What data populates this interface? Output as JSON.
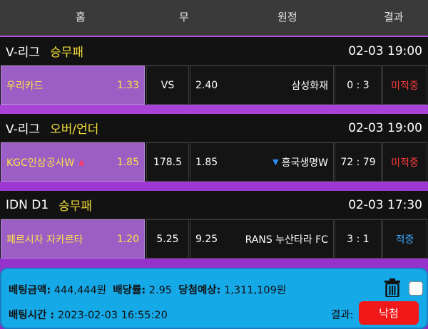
{
  "header": {
    "home": "홈",
    "draw": "무",
    "away": "원정",
    "result": "결과"
  },
  "matches": [
    {
      "league": "V-리그",
      "market": "승무패",
      "time": "02-03 19:00",
      "home_team": "우리카드",
      "home_odds": "1.33",
      "draw": "VS",
      "away_odds": "2.40",
      "away_team": "삼성화재",
      "score": "0 : 3",
      "result": "미적중"
    },
    {
      "league": "V-리그",
      "market": "오버/언더",
      "time": "02-03 19:00",
      "home_team": "KGC인삼공사W",
      "home_arrow": "▲",
      "home_odds": "1.85",
      "draw": "178.5",
      "away_arrow": "▼",
      "away_odds": "1.85",
      "away_team": "흥국생명W",
      "score": "72 : 79",
      "result": "미적중"
    },
    {
      "league": "IDN D1",
      "market": "승무패",
      "time": "02-03 17:30",
      "home_team": "페르시자 자카르타",
      "home_odds": "1.20",
      "draw": "5.25",
      "away_odds": "9.25",
      "away_team": "RANS 누산타라 FC",
      "score": "3 : 1",
      "result": "적중"
    }
  ],
  "bet": {
    "amount_label": "베팅금액:",
    "amount": "444,444원",
    "rate_label": "배당률:",
    "rate": "2.95",
    "expected_label": "당첨예상:",
    "expected": "1,311,109원",
    "time_label": "배팅시간 :",
    "time": "2023-02-03 16:55:20",
    "result_label": "결과:",
    "result_button": "낙첨"
  },
  "icons": {
    "delete": "trash-icon",
    "select": "checkbox"
  },
  "colors": {
    "miss": "#ff3b3b",
    "hit": "#3ea9ff",
    "market": "#f2dd3a",
    "home_bg": "#9a5ec4",
    "footer_bg": "#15a9e8",
    "result_button": "#f01818"
  }
}
